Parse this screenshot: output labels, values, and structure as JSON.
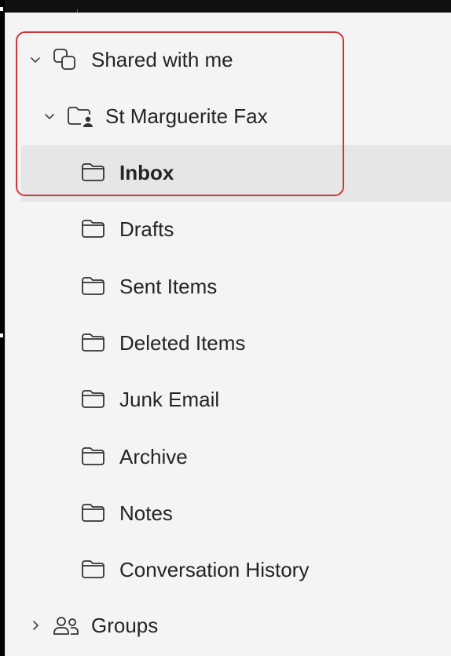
{
  "folders": {
    "shared_label": "Shared with me",
    "mailbox_label": "St Marguerite Fax",
    "items": [
      {
        "label": "Inbox",
        "selected": true
      },
      {
        "label": "Drafts"
      },
      {
        "label": "Sent Items"
      },
      {
        "label": "Deleted Items"
      },
      {
        "label": "Junk Email"
      },
      {
        "label": "Archive"
      },
      {
        "label": "Notes"
      },
      {
        "label": "Conversation History"
      }
    ],
    "groups_label": "Groups"
  },
  "colors": {
    "highlight_border": "#d13438",
    "selected_background": "#e6e6e6",
    "pane_background": "#f4f4f4"
  }
}
